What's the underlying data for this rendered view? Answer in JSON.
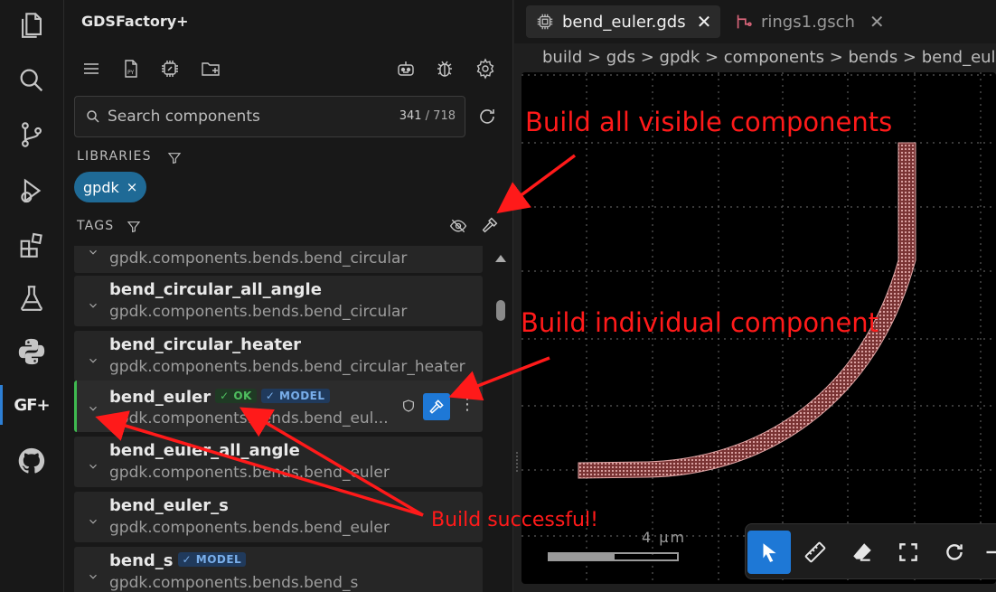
{
  "sidebar": {
    "title": "GDSFactory+",
    "search": {
      "placeholder": "Search components",
      "count_visible": "341",
      "count_total": "718"
    },
    "libraries_label": "LIBRARIES",
    "library_chip": "gpdk",
    "tags_label": "TAGS",
    "components": [
      {
        "name": "",
        "sub": "gpdk.components.bends.bend_circular"
      },
      {
        "name": "bend_circular_all_angle",
        "sub": "gpdk.components.bends.bend_circular"
      },
      {
        "name": "bend_circular_heater",
        "sub": "gpdk.components.bends.bend_circular_heater"
      },
      {
        "name": "bend_euler",
        "sub": "gpdk.components.bends.bend_eul...",
        "badge_ok": "OK",
        "badge_model": "MODEL"
      },
      {
        "name": "bend_euler_all_angle",
        "sub": "gpdk.components.bends.bend_euler"
      },
      {
        "name": "bend_euler_s",
        "sub": "gpdk.components.bends.bend_euler"
      },
      {
        "name": "bend_s",
        "sub": "gpdk.components.bends.bend_s",
        "badge_model": "MODEL"
      }
    ]
  },
  "activity": {
    "gf_label": "GF+"
  },
  "editor": {
    "tabs": [
      {
        "label": "bend_euler.gds",
        "active": true
      },
      {
        "label": "rings1.gsch",
        "active": false
      }
    ],
    "breadcrumb": "build > gds > gpdk > components > bends > bend_euler",
    "scale_label": "4 µm"
  },
  "annotations": {
    "build_all": "Build all visible components",
    "build_individual": "Build individual component",
    "build_success": "Build successful!"
  },
  "colors": {
    "accent": "#1e78d6",
    "chip": "#1f6a96",
    "ok": "#3fb950",
    "annotation": "#ff1a1a",
    "waveguide": "#c98c8c"
  }
}
